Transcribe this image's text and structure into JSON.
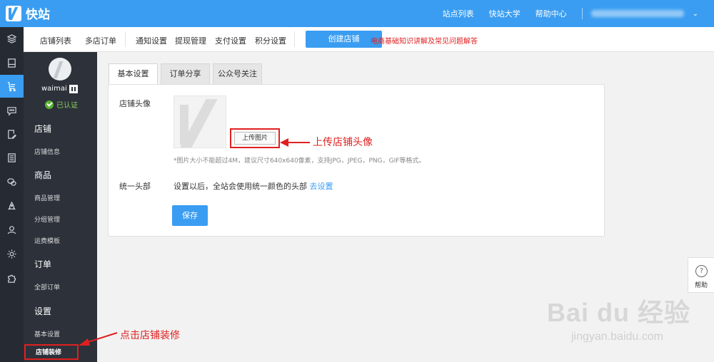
{
  "app": {
    "logo_text": "快站"
  },
  "topnav": {
    "links": [
      "站点列表",
      "快站大学",
      "帮助中心"
    ],
    "user_caret": "⌄"
  },
  "rail": {
    "icons": [
      "layers-icon",
      "store-icon",
      "cart-icon",
      "chat-icon",
      "edit-doc-icon",
      "list-icon",
      "wechat-icon",
      "rocket-icon",
      "user-icon",
      "gear-icon",
      "puzzle-icon"
    ],
    "active_index": 2
  },
  "subnav": {
    "items": [
      "店铺列表",
      "多店订单",
      "通知设置",
      "提现管理",
      "支付设置",
      "积分设置"
    ],
    "create_label": "创建店铺",
    "promo": "电商基础知识讲解及常见问题解答"
  },
  "store": {
    "name": "waimai",
    "verified": "已认证"
  },
  "sidebar": {
    "groups": [
      {
        "label": "店铺",
        "items": [
          "店铺信息"
        ]
      },
      {
        "label": "商品",
        "items": [
          "商品管理",
          "分组管理",
          "运费模板"
        ]
      },
      {
        "label": "订单",
        "items": [
          "全部订单"
        ]
      },
      {
        "label": "设置",
        "items": [
          "基本设置",
          "店铺装修"
        ]
      }
    ],
    "active_item": "店铺装修"
  },
  "tabs": [
    "基本设置",
    "订单分享",
    "公众号关注"
  ],
  "form": {
    "avatar_label": "店铺头像",
    "upload_label": "上传图片",
    "hint": "*图片大小不能超过4M，建议尺寸640x640像素，支持JPG，JPEG，PNG，GIF等格式。",
    "header_label": "统一头部",
    "header_text": "设置以后，全站会使用统一颜色的头部",
    "header_link": "去设置",
    "save_label": "保存"
  },
  "annotations": {
    "upload": "上传店铺头像",
    "decorate": "点击店铺装修"
  },
  "help": {
    "label": "帮助",
    "icon": "?"
  },
  "watermark": {
    "logo": "Bai du 经验",
    "url": "jingyan.baidu.com"
  },
  "colors": {
    "primary": "#3a9df1",
    "rail_bg": "#262b33",
    "sidebar_bg": "#2c313a",
    "annotation": "#e02020",
    "verified": "#58b32f"
  }
}
